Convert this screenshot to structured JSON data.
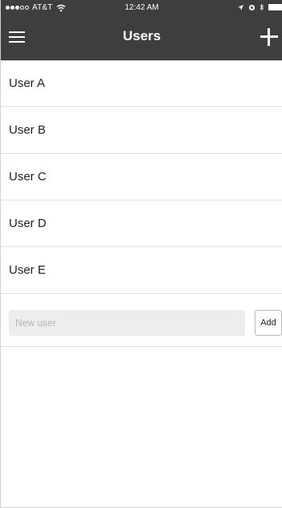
{
  "status_bar": {
    "carrier": "AT&T",
    "time": "12:42 AM"
  },
  "nav": {
    "title": "Users",
    "menu_icon": "hamburger-menu-icon",
    "add_icon": "plus-icon"
  },
  "users": [
    {
      "name": "User A"
    },
    {
      "name": "User B"
    },
    {
      "name": "User C"
    },
    {
      "name": "User D"
    },
    {
      "name": "User E"
    }
  ],
  "new_user": {
    "placeholder": "New user",
    "value": "",
    "add_label": "Add"
  },
  "colors": {
    "header_bg": "#3e3e3e",
    "divider": "#e1e1e1",
    "input_bg": "#ededed"
  }
}
